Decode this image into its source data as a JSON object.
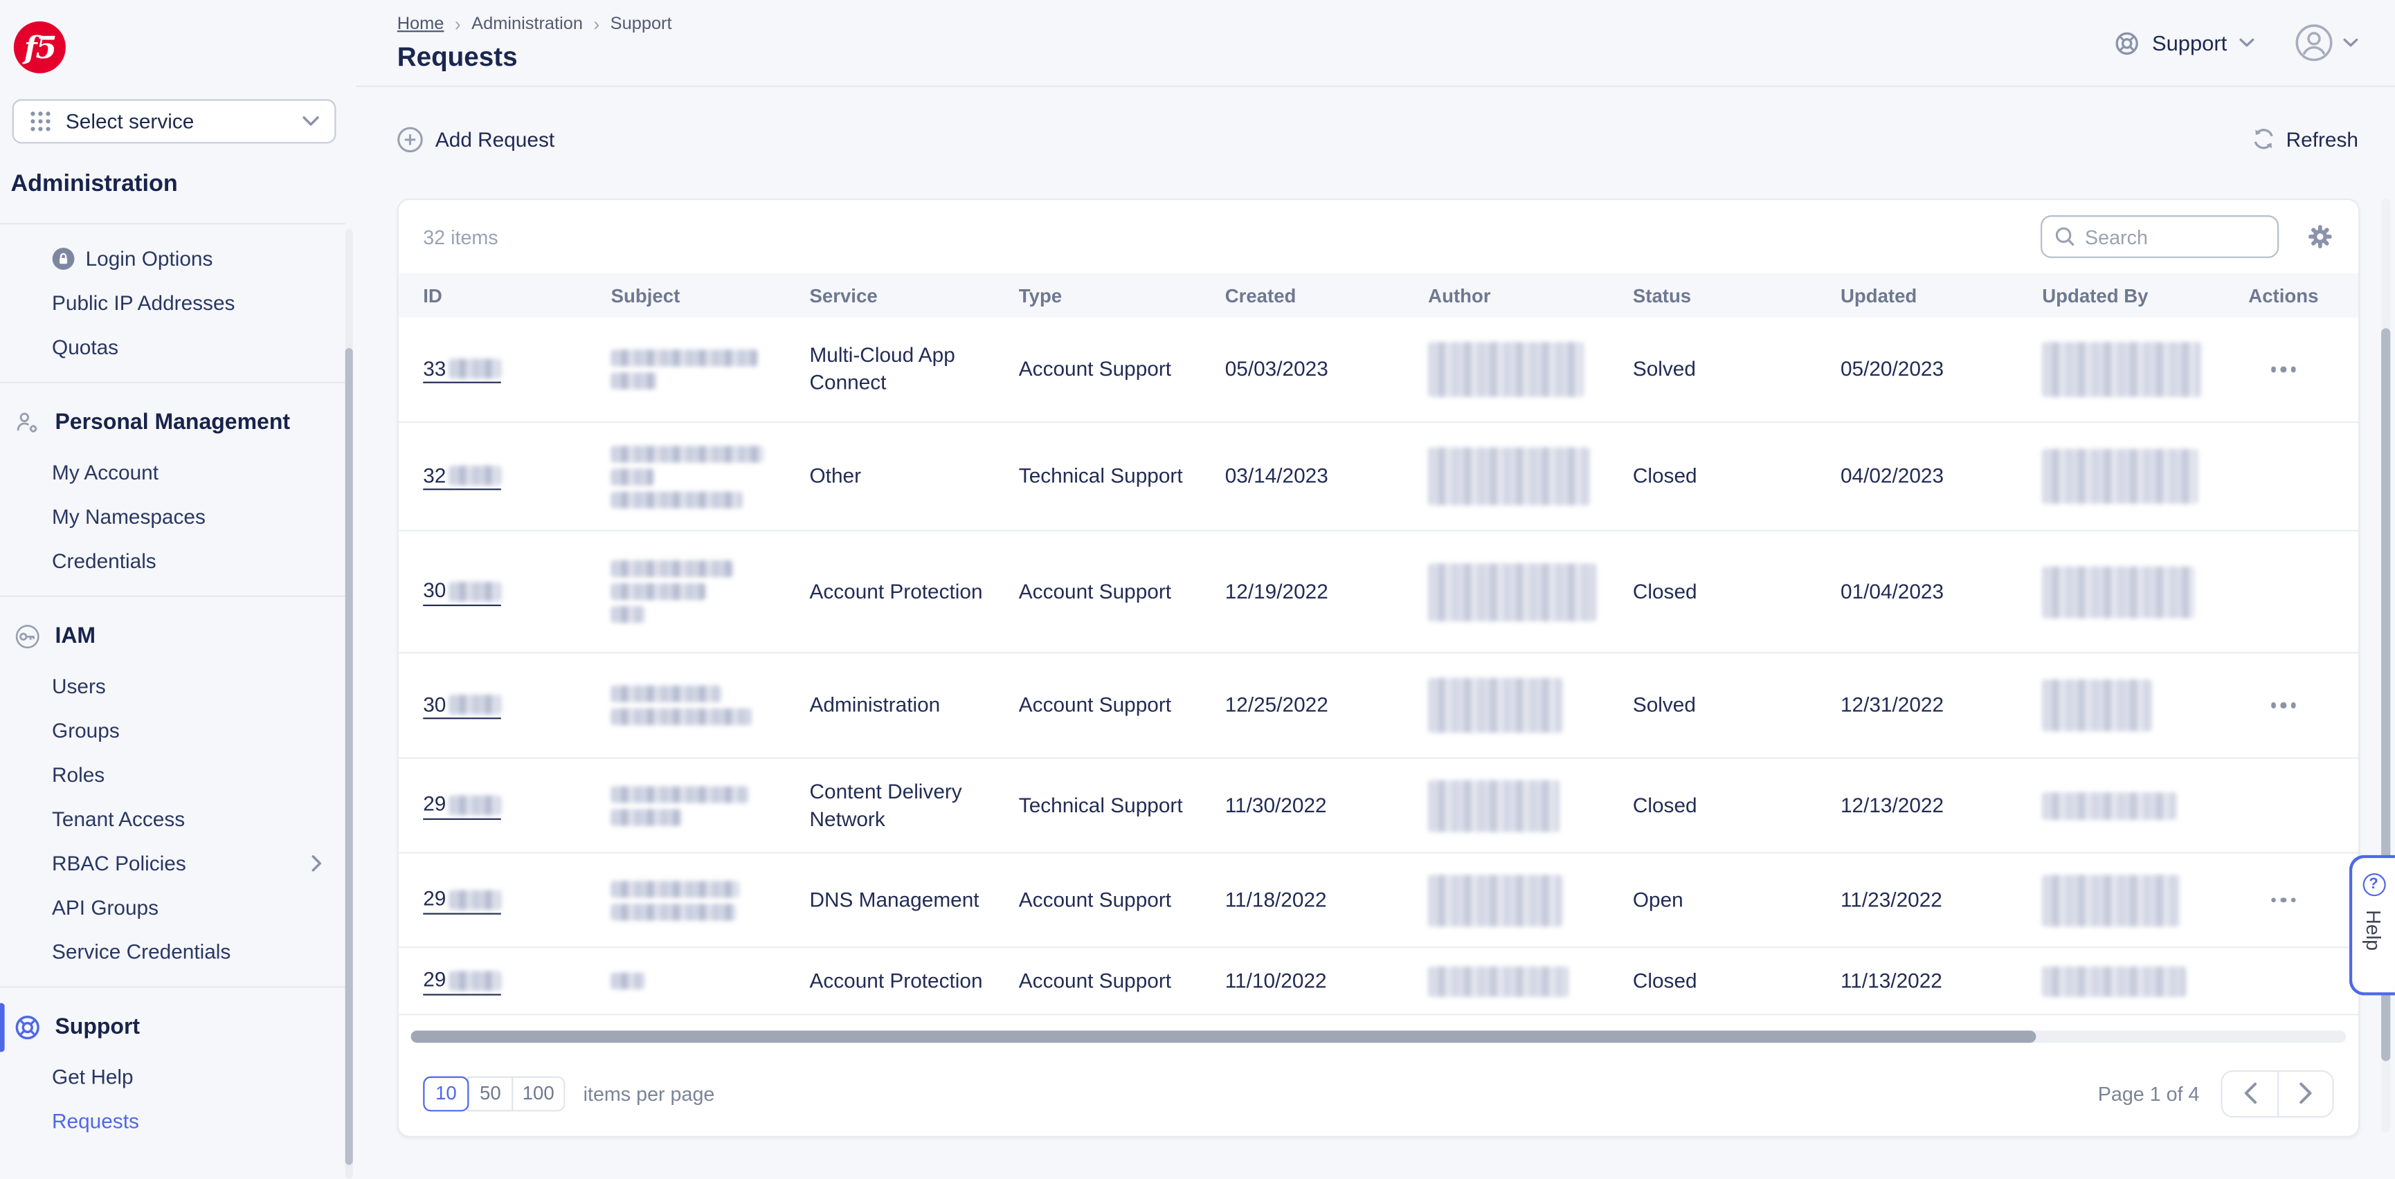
{
  "app": {
    "logo_text": "f5"
  },
  "sidebar": {
    "select_service": "Select service",
    "admin_title": "Administration",
    "groups": [
      {
        "items": [
          {
            "label": "Login Options"
          },
          {
            "label": "Public IP Addresses"
          },
          {
            "label": "Quotas"
          }
        ]
      },
      {
        "title": "Personal Management",
        "items": [
          {
            "label": "My Account"
          },
          {
            "label": "My Namespaces"
          },
          {
            "label": "Credentials"
          }
        ]
      },
      {
        "title": "IAM",
        "items": [
          {
            "label": "Users"
          },
          {
            "label": "Groups"
          },
          {
            "label": "Roles"
          },
          {
            "label": "Tenant Access"
          },
          {
            "label": "RBAC Policies"
          },
          {
            "label": "API Groups"
          },
          {
            "label": "Service Credentials"
          }
        ]
      },
      {
        "title": "Support",
        "items": [
          {
            "label": "Get Help"
          },
          {
            "label": "Requests"
          }
        ]
      }
    ]
  },
  "header": {
    "breadcrumb": [
      "Home",
      "Administration",
      "Support"
    ],
    "title": "Requests",
    "support_label": "Support"
  },
  "toolbar": {
    "add_request": "Add Request",
    "refresh": "Refresh"
  },
  "panel": {
    "items_count": "32 items",
    "search_placeholder": "Search"
  },
  "table": {
    "columns": [
      "ID",
      "Subject",
      "Service",
      "Type",
      "Created",
      "Author",
      "Status",
      "Updated",
      "Updated By",
      "Actions"
    ],
    "rows": [
      {
        "id_prefix": "33",
        "id_blur_w": 34,
        "subject_blur": [
          96,
          30
        ],
        "service": "Multi-Cloud App Connect",
        "type": "Account Support",
        "created": "05/03/2023",
        "author_blur": [
          102,
          36
        ],
        "status": "Solved",
        "updated": "05/20/2023",
        "updated_by_blur": [
          104,
          36
        ],
        "actions": true,
        "h": 69
      },
      {
        "id_prefix": "32",
        "id_blur_w": 34,
        "subject_blur": [
          100,
          28,
          86
        ],
        "service": "Other",
        "type": "Technical Support",
        "created": "03/14/2023",
        "author_blur": [
          106,
          38
        ],
        "status": "Closed",
        "updated": "04/02/2023",
        "updated_by_blur": [
          102,
          36
        ],
        "actions": false,
        "h": 71
      },
      {
        "id_prefix": "30",
        "id_blur_w": 34,
        "subject_blur": [
          80,
          62,
          22
        ],
        "service": "Account Protection",
        "type": "Account Support",
        "created": "12/19/2022",
        "author_blur": [
          110,
          38
        ],
        "status": "Closed",
        "updated": "01/04/2023",
        "updated_by_blur": [
          100,
          34
        ],
        "actions": false,
        "h": 80
      },
      {
        "id_prefix": "30",
        "id_blur_w": 34,
        "subject_blur": [
          72,
          92
        ],
        "service": "Administration",
        "type": "Account Support",
        "created": "12/25/2022",
        "author_blur": [
          88,
          36
        ],
        "status": "Solved",
        "updated": "12/31/2022",
        "updated_by_blur": [
          72,
          34
        ],
        "actions": true,
        "h": 69
      },
      {
        "id_prefix": "29",
        "id_blur_w": 34,
        "subject_blur": [
          90,
          46
        ],
        "service": "Content Delivery Network",
        "type": "Technical Support",
        "created": "11/30/2022",
        "author_blur": [
          86,
          34
        ],
        "status": "Closed",
        "updated": "12/13/2022",
        "updated_by_blur": [
          88,
          18
        ],
        "actions": false,
        "h": 62
      },
      {
        "id_prefix": "29",
        "id_blur_w": 34,
        "subject_blur": [
          84,
          82
        ],
        "service": "DNS Management",
        "type": "Account Support",
        "created": "11/18/2022",
        "author_blur": [
          88,
          34
        ],
        "status": "Open",
        "updated": "11/23/2022",
        "updated_by_blur": [
          90,
          34
        ],
        "actions": true,
        "h": 62
      },
      {
        "id_prefix": "29",
        "id_blur_w": 34,
        "subject_blur": [
          22
        ],
        "service": "Account Protection",
        "type": "Account Support",
        "created": "11/10/2022",
        "author_blur": [
          92,
          20
        ],
        "status": "Closed",
        "updated": "11/13/2022",
        "updated_by_blur": [
          94,
          20
        ],
        "actions": false,
        "h": 44
      }
    ]
  },
  "pagination": {
    "sizes": [
      "10",
      "50",
      "100"
    ],
    "active_size": "10",
    "items_per_page_label": "items per page",
    "page_info": "Page 1 of 4"
  },
  "help_tab": {
    "label": "Help"
  },
  "colors": {
    "accent": "#4e68e8",
    "navy": "#222c55",
    "f5_red": "#e4002b"
  }
}
